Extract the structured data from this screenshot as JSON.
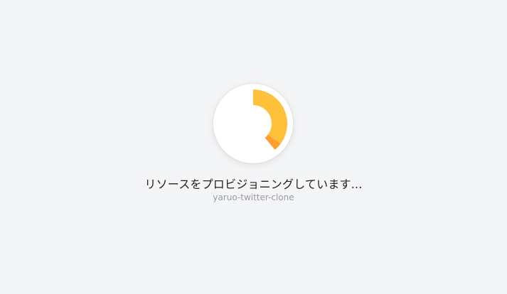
{
  "loading": {
    "status_text": "リソースをプロビジョニングしています...",
    "project_name": "yaruo-twitter-clone",
    "icon": "progress-ring-icon",
    "progress": 0.39,
    "colors": {
      "background": "#f4f5f7",
      "arc_primary": "#ffc13b",
      "arc_tail": "#ff9f2e"
    }
  }
}
